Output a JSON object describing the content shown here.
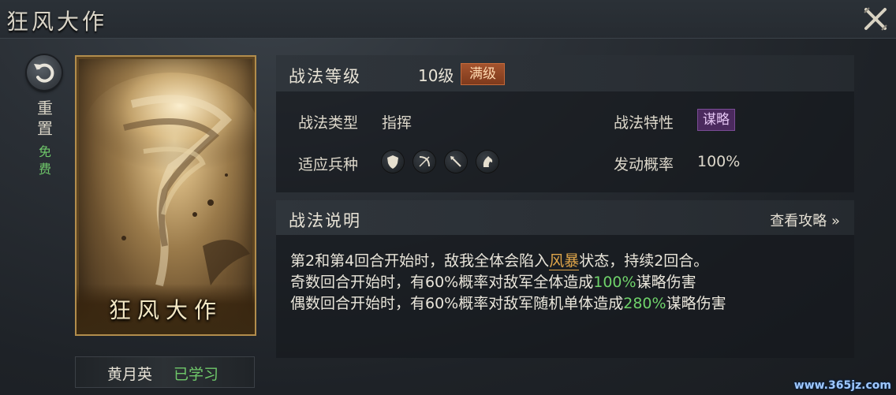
{
  "window": {
    "title": "狂风大作"
  },
  "sidebar": {
    "reset_label": "重置",
    "free_label": "免费"
  },
  "card": {
    "name": "狂风大作",
    "owner_name": "黄月英",
    "owner_status": "已学习"
  },
  "level_panel": {
    "label": "战法等级",
    "level_value": "10级",
    "max_badge": "满级",
    "type_label": "战法类型",
    "type_value": "指挥",
    "trait_label": "战法特性",
    "trait_value": "谋略",
    "unit_label": "适应兵种",
    "unit_icons": [
      "shield-icon",
      "bow-icon",
      "spear-icon",
      "horse-icon"
    ],
    "chance_label": "发动概率",
    "chance_value": "100%"
  },
  "desc_panel": {
    "label": "战法说明",
    "guide_link": "查看攻略 »",
    "line1_a": "第2和第4回合开始时，敌我全体会陷入",
    "line1_kw": "风暴",
    "line1_b": "状态，持续2回合。",
    "line2_a": "奇数回合开始时，有60%概率对敌军全体造成",
    "line2_num": "100%",
    "line2_b": "谋略伤害",
    "line3_a": "偶数回合开始时，有60%概率对敌军随机单体造成",
    "line3_num": "280%",
    "line3_b": "谋略伤害"
  },
  "colors": {
    "accent_green": "#6fc86a",
    "badge_orange": "#a4542e",
    "badge_purple": "#4b2a5e",
    "keyword_gold": "#e0a64a"
  },
  "watermark": "www.365jz.com"
}
